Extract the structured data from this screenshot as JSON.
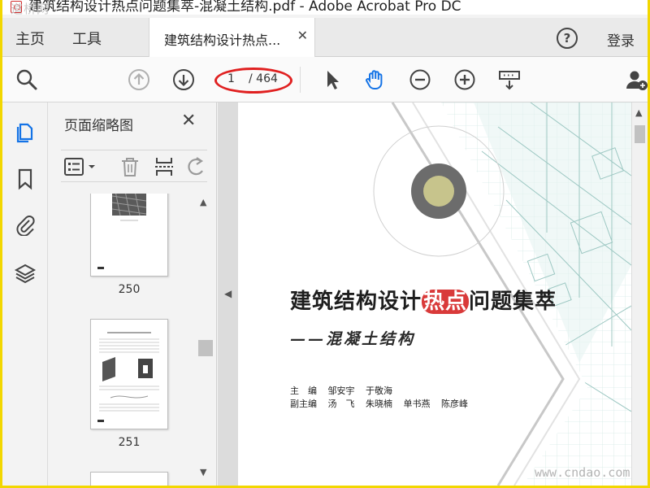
{
  "window": {
    "title": "建筑结构设计热点问题集萃-混凝土结构.pdf - Adobe Acrobat Pro DC",
    "watermark": "道桥网"
  },
  "tabs": {
    "home": "主页",
    "tools": "工具",
    "document": "建筑结构设计热点...",
    "login": "登录"
  },
  "toolbar": {
    "current_page": "1",
    "total_pages": "/ 464"
  },
  "thumbnails": {
    "title": "页面缩略图",
    "items": [
      {
        "page": "250"
      },
      {
        "page": "251"
      }
    ]
  },
  "document": {
    "title_part1": "建筑结构设计",
    "title_highlight": "热点",
    "title_part2": "问题集萃",
    "subtitle": "——混凝土结构",
    "editor_role": "主　编",
    "editors": [
      "邹安宇",
      "于敬海"
    ],
    "deputy_role": "副主编",
    "deputies": [
      "汤　飞",
      "朱晓楠",
      "单书燕",
      "陈彦峰"
    ],
    "watermark": "www.cndao.com"
  },
  "colors": {
    "accent_blue": "#1473e6",
    "annotation_red": "#e02020",
    "title_highlight": "#d93a3a"
  }
}
